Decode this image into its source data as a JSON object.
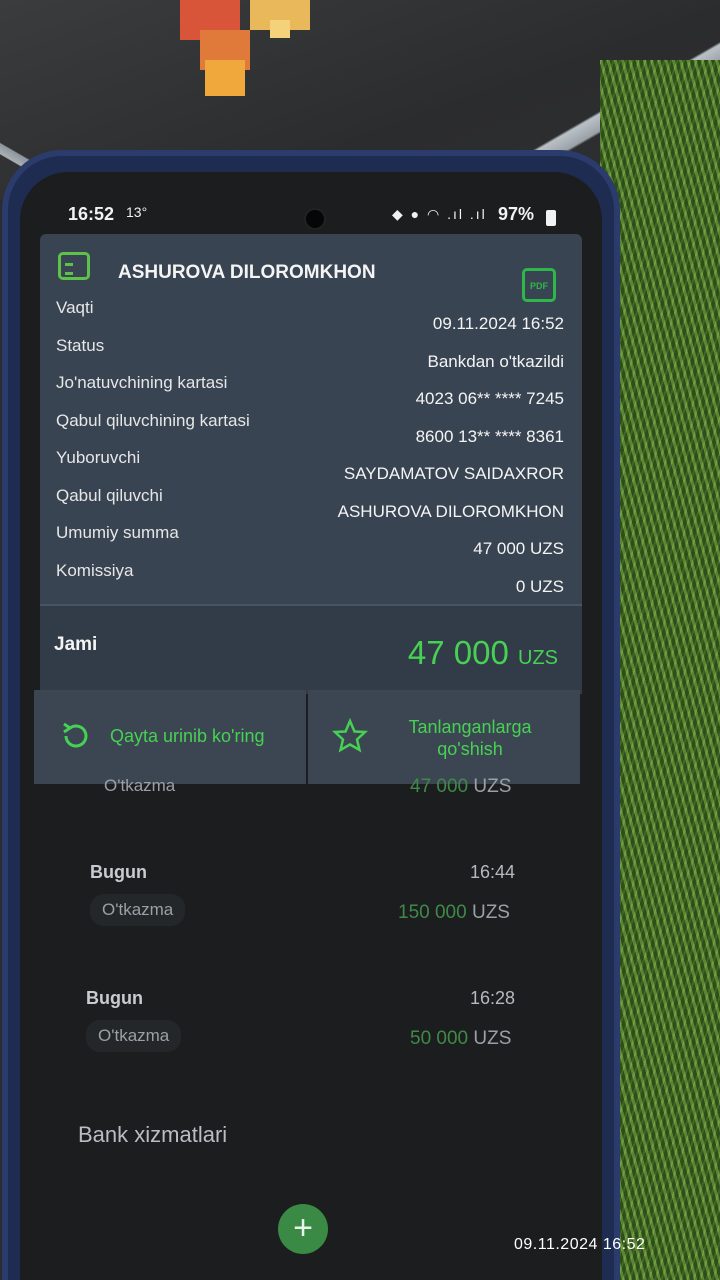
{
  "status_bar": {
    "time": "16:52",
    "temperature": "13°",
    "icons": "◆ ● ◠ .ıl .ıl",
    "battery": "97%"
  },
  "receipt": {
    "recipient_name": "ASHUROVA DILOROMKHON",
    "pdf_label": "PDF",
    "rows": [
      {
        "label": "Vaqti",
        "value": "09.11.2024 16:52"
      },
      {
        "label": "Status",
        "value": "Bankdan o'tkazildi"
      },
      {
        "label": "Jo'natuvchining kartasi",
        "value": "4023 06** **** 7245"
      },
      {
        "label": "Qabul qiluvchining kartasi",
        "value": "8600 13** **** 8361"
      },
      {
        "label": "Yuboruvchi",
        "value": "SAYDAMATOV SAIDAXROR"
      },
      {
        "label": "Qabul qiluvchi",
        "value": "ASHUROVA DILOROMKHON"
      },
      {
        "label": "Umumiy summa",
        "value": "47 000 UZS"
      },
      {
        "label": "Komissiya",
        "value": "0 UZS"
      }
    ],
    "total_label": "Jami",
    "total_amount": "47 000",
    "total_currency": "UZS"
  },
  "actions": {
    "retry_label": "Qayta urinib ko'ring",
    "favorite_label": "Tanlanganlarga qo'shish"
  },
  "history": [
    {
      "type": "O'tkazma",
      "amount": "47 000",
      "currency": "UZS"
    },
    {
      "day": "Bugun",
      "time": "16:44",
      "type": "O'tkazma",
      "amount": "150 000",
      "currency": "UZS"
    },
    {
      "day": "Bugun",
      "time": "16:28",
      "type": "O'tkazma",
      "amount": "50 000",
      "currency": "UZS"
    }
  ],
  "bank_services_title": "Bank xizmatlari",
  "add_icon": "+",
  "photo_timestamp": "09.11.2024  16:52",
  "colors": {
    "accent_green": "#46d153",
    "card_bg": "#394452",
    "case_blue": "#1f2c52"
  }
}
